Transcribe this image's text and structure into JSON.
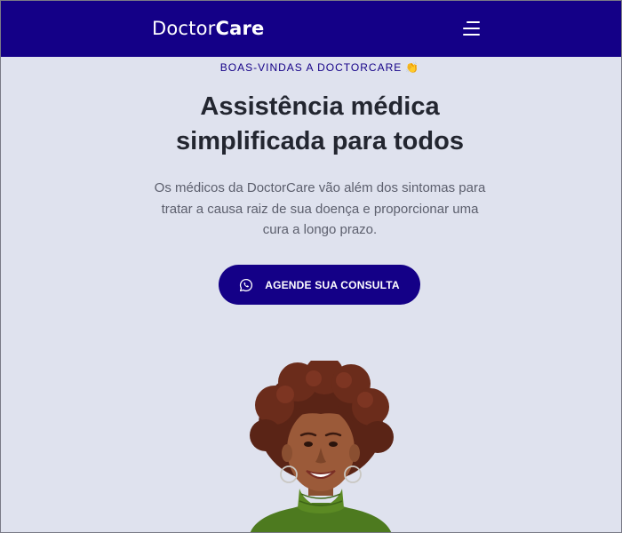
{
  "header": {
    "logo_light": "Doctor",
    "logo_bold": "Care",
    "menu_icon": "hamburger-menu-icon",
    "background": "#140087"
  },
  "hero": {
    "eyebrow": "BOAS-VINDAS A DOCTORCARE",
    "eyebrow_emoji": "👏",
    "title_line1": "Assistência médica",
    "title_line2": "simplificada para todos",
    "lead_line1": "Os médicos da DoctorCare vão além dos sintomas para",
    "lead_line2": "tratar a causa raiz de sua doença e proporcionar uma",
    "lead_line3": "cura a longo prazo.",
    "cta_label": "AGENDE SUA CONSULTA",
    "cta_icon": "whatsapp-icon",
    "photo": "smiling-woman-photo"
  },
  "colors": {
    "primary": "#140087",
    "background": "#dfe2ee",
    "title": "#232630",
    "text": "#5c5f6d",
    "sweater": "#4d7a1f"
  }
}
